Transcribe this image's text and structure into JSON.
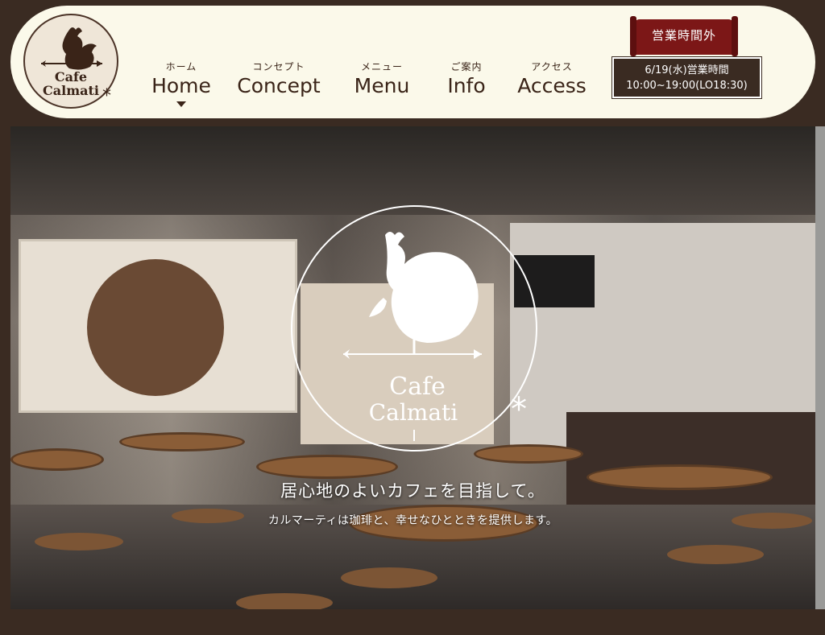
{
  "logo": {
    "line1": "Cafe",
    "line2": "Calmati",
    "mark": "rooster-icon",
    "star": "*"
  },
  "nav": {
    "items": [
      {
        "jp": "ホーム",
        "en": "Home",
        "active": true
      },
      {
        "jp": "コンセプト",
        "en": "Concept"
      },
      {
        "jp": "メニュー",
        "en": "Menu"
      },
      {
        "jp": "ご案内",
        "en": "Info"
      },
      {
        "jp": "アクセス",
        "en": "Access"
      }
    ]
  },
  "status": {
    "flag": "営業時間外",
    "hours_line1": "6/19(水)営業時間",
    "hours_line2": "10:00~19:00(LO18:30)"
  },
  "hero": {
    "emblem_text_line1": "Cafe",
    "emblem_text_line2": "Calmati",
    "tagline": "居心地のよいカフェを目指して。",
    "subtagline": "カルマーティは珈琲と、幸せなひとときを提供します。"
  },
  "colors": {
    "header_bg": "#fbf9ea",
    "page_bg": "#3a2b22",
    "status_red": "#7c1717",
    "text_dark": "#3a2418"
  }
}
